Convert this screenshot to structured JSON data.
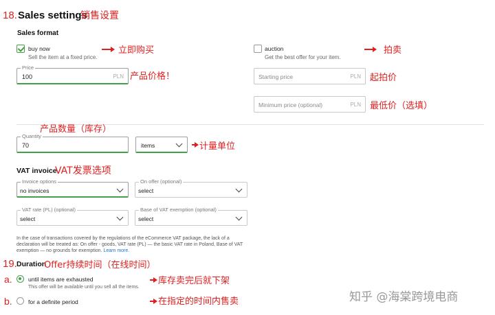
{
  "section18": {
    "number": "18.",
    "title": "Sales settings",
    "title_note": "销售设置"
  },
  "sales_format": {
    "heading": "Sales format",
    "buy_now": {
      "label": "buy now",
      "description": "Sell the item at a fixed price.",
      "checked": true,
      "note": "立即购买"
    },
    "auction": {
      "label": "auction",
      "description": "Get the best offer for your item.",
      "checked": false,
      "note": "拍卖"
    }
  },
  "price": {
    "label": "Price",
    "value": "100",
    "unit": "PLN",
    "note": "产品价格！"
  },
  "starting_price": {
    "placeholder": "Starting price",
    "unit": "PLN",
    "note": "起拍价"
  },
  "minimum_price": {
    "placeholder": "Minimum price (optional)",
    "unit": "PLN",
    "note": "最低价（选填）"
  },
  "quantity": {
    "note_above": "产品数量（库存）",
    "label": "Quantity",
    "value": "70",
    "unit_select": "items",
    "note": "计量单位"
  },
  "vat": {
    "heading": "VAT invoice",
    "heading_note": "VAT发票选项",
    "invoice_options": {
      "label": "Invoice options",
      "value": "no invoices"
    },
    "on_offer": {
      "label": "On offer (optional)",
      "value": "select"
    },
    "vat_rate": {
      "label": "VAT rate (PL) (optional)",
      "value": "select"
    },
    "base_exemption": {
      "label": "Base of VAT exemption (optional)",
      "value": "select"
    },
    "info_line1": "In the case of transactions covered by the regulations of the eCommerce VAT package, the lack of a",
    "info_line2": "declaration will be treated as: On offer - goods, VAT rate (PL) — the basic VAT rate in Poland, Base of VAT",
    "info_line3": "exemption — no grounds for exemption.",
    "learn_more": "Learn more."
  },
  "section19": {
    "number": "19.",
    "title": "Duration",
    "title_note": "Offer持续时间（在线时间）",
    "option_a": {
      "marker": "a.",
      "label": "until items are exhausted",
      "description": "This offer will be available until you sell all the items.",
      "selected": true,
      "note": "库存卖完后就下架"
    },
    "option_b": {
      "marker": "b.",
      "label": "for a definite period",
      "selected": false,
      "note": "在指定的时间内售卖"
    }
  },
  "watermark": "知乎 @海棠跨境电商",
  "colors": {
    "accent_green": "#43a047",
    "annotation_red": "#e02020",
    "link_blue": "#1a73c8"
  }
}
